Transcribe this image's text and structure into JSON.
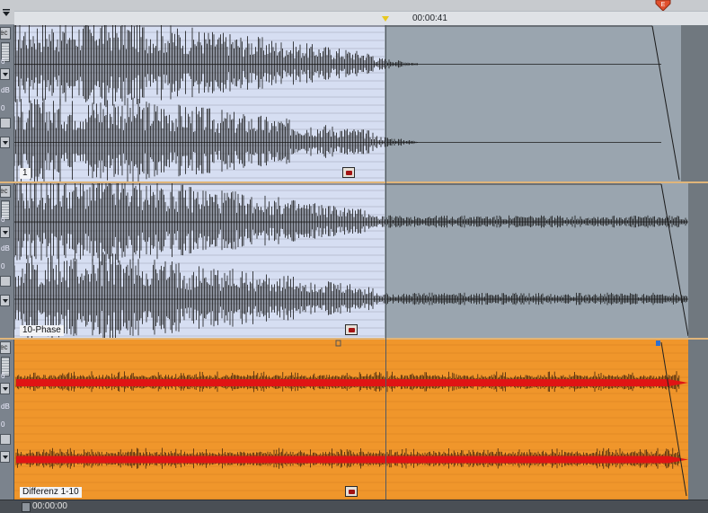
{
  "ruler": {
    "time": "00:00:41",
    "end_marker_label": "E",
    "colors": {
      "ruler": "#c7cace",
      "start_marker": "#e8c820",
      "end_marker": "#e0502e"
    }
  },
  "tracks": [
    {
      "label": "1",
      "controls": {
        "btn_top": "ec",
        "level_label": "6",
        "db_label": "dB",
        "zero_label": "0"
      },
      "colors": {
        "wave_bg_selected": "#d6def2",
        "wave_bg": "#9aa5af",
        "wave": "#161616"
      }
    },
    {
      "label": "10-Phase",
      "controls": {
        "btn_top": "ec",
        "level_label": "6",
        "db_label": "dB",
        "zero_label": "0"
      },
      "colors": {
        "wave_bg_selected": "#d6def2",
        "wave_bg": "#9aa5af",
        "wave": "#161616"
      }
    },
    {
      "label": "Differenz 1-10",
      "controls": {
        "btn_top": "ec",
        "level_label": "6",
        "db_label": "dB",
        "zero_label": "0"
      },
      "colors": {
        "wave_bg": "#f0962b",
        "wave": "#e01414",
        "wave_outline": "#2b1408"
      }
    }
  ],
  "statusbar": {
    "time": "00:00:00"
  }
}
